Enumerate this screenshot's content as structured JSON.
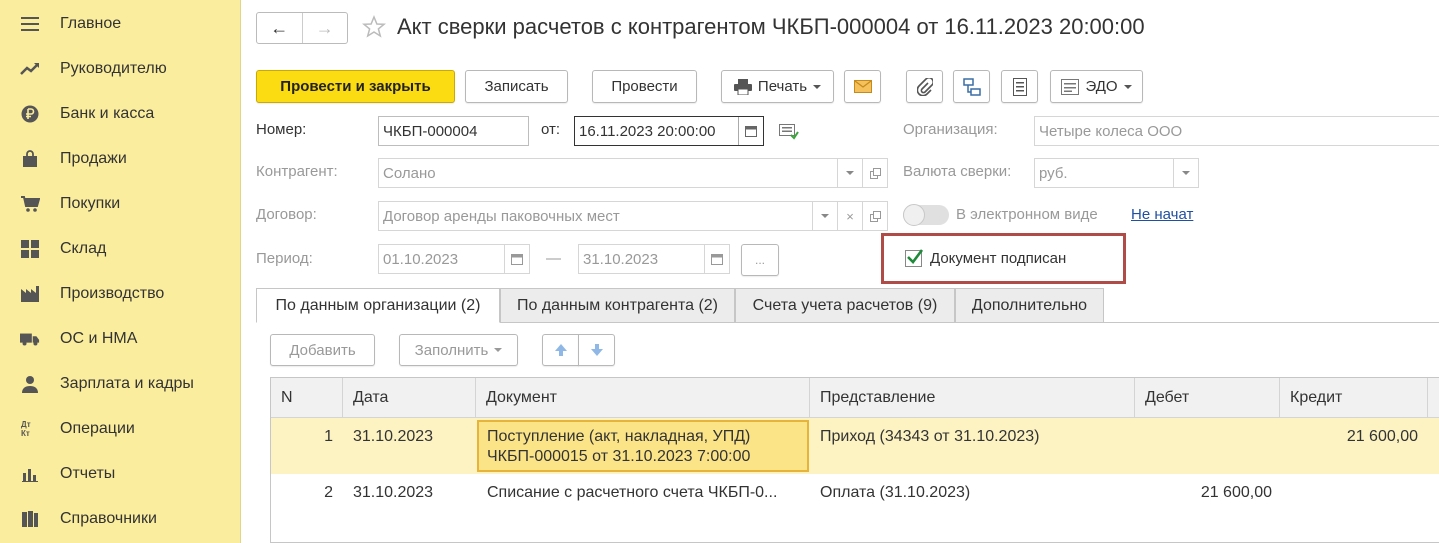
{
  "sidebar": {
    "items": [
      {
        "label": "Главное",
        "icon": "menu-icon"
      },
      {
        "label": "Руководителю",
        "icon": "trend-icon"
      },
      {
        "label": "Банк и касса",
        "icon": "ruble-icon"
      },
      {
        "label": "Продажи",
        "icon": "bag-icon"
      },
      {
        "label": "Покупки",
        "icon": "cart-icon"
      },
      {
        "label": "Склад",
        "icon": "grid-icon"
      },
      {
        "label": "Производство",
        "icon": "factory-icon"
      },
      {
        "label": "ОС и НМА",
        "icon": "truck-icon"
      },
      {
        "label": "Зарплата и кадры",
        "icon": "person-icon"
      },
      {
        "label": "Операции",
        "icon": "dt-kt-icon"
      },
      {
        "label": "Отчеты",
        "icon": "bar-chart-icon"
      },
      {
        "label": "Справочники",
        "icon": "books-icon"
      }
    ],
    "dt_kt_text": "Дт Кт"
  },
  "header": {
    "back": "←",
    "forward": "→",
    "title": "Акт сверки расчетов с контрагентом ЧКБП-000004 от 16.11.2023 20:00:00"
  },
  "toolbar": {
    "post_close": "Провести и закрыть",
    "save": "Записать",
    "post": "Провести",
    "print": "Печать",
    "edo": "ЭДО"
  },
  "form": {
    "number_label": "Номер:",
    "number_value": "ЧКБП-000004",
    "date_label": "от:",
    "date_value": "16.11.2023 20:00:00",
    "org_label": "Организация:",
    "org_value": "Четыре колеса ООО",
    "counterparty_label": "Контрагент:",
    "counterparty_value": "Солано",
    "currency_label": "Валюта сверки:",
    "currency_value": "руб.",
    "contract_label": "Договор:",
    "contract_value": "Договор аренды паковочных мест",
    "electronic_label": "В электронном виде",
    "electronic_status": "Не начат",
    "period_label": "Период:",
    "period_from": "01.10.2023",
    "period_dash": "—",
    "period_to": "31.10.2023",
    "period_more": "...",
    "signed_label": "Документ подписан"
  },
  "tabs": [
    "По данным организации (2)",
    "По данным контрагента (2)",
    "Счета учета расчетов (9)",
    "Дополнительно"
  ],
  "table_toolbar": {
    "add": "Добавить",
    "fill": "Заполнить"
  },
  "table": {
    "columns": [
      "N",
      "Дата",
      "Документ",
      "Представление",
      "Дебет",
      "Кредит"
    ],
    "rows": [
      {
        "n": "1",
        "date": "31.10.2023",
        "doc_line1": "Поступление (акт, накладная, УПД)",
        "doc_line2": "ЧКБП-000015 от 31.10.2023 7:00:00",
        "repr": "Приход (34343 от 31.10.2023)",
        "debit": "",
        "credit": "21 600,00"
      },
      {
        "n": "2",
        "date": "31.10.2023",
        "doc_line1": "Списание с расчетного счета ЧКБП-0...",
        "doc_line2": "",
        "repr": "Оплата (31.10.2023)",
        "debit": "21 600,00",
        "credit": ""
      }
    ]
  },
  "colors": {
    "sidebar_bg": "#fbed9e",
    "primary_button": "#fbdc13",
    "highlight_border": "#b04c48",
    "selected_row": "#fcf2c2",
    "link": "#2050a0"
  }
}
